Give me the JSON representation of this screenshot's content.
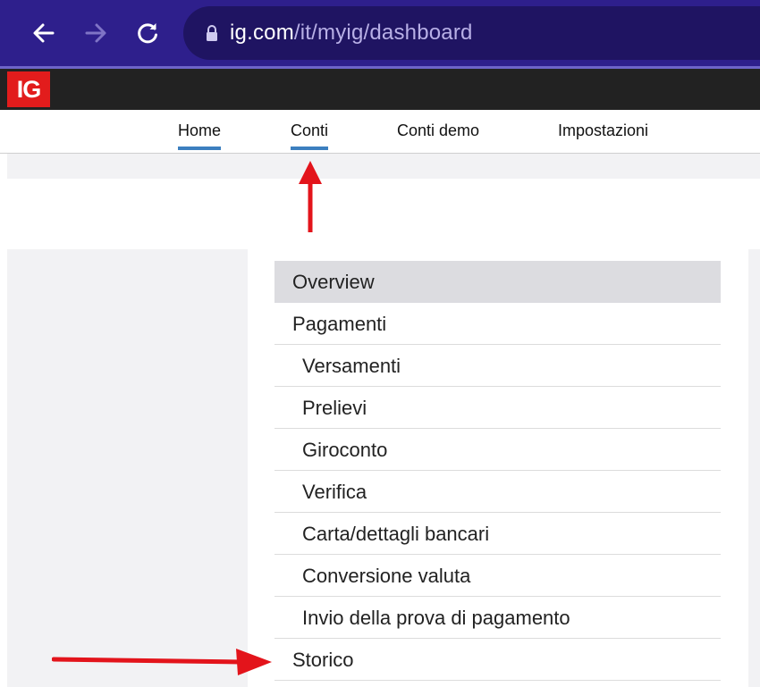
{
  "browser": {
    "url_host": "ig.com",
    "url_path": "/it/myig/dashboard"
  },
  "brand": {
    "logo_text": "IG",
    "logo_color": "#e21c1c",
    "bar_color": "#222222"
  },
  "colors": {
    "browser_bar": "#2e1f8c",
    "address_bar": "#1f1462",
    "tab_underline": "#3c7fbf",
    "arrow": "#e3141b"
  },
  "tabs": [
    {
      "label": "Home",
      "active": false
    },
    {
      "label": "Conti",
      "active": true
    },
    {
      "label": "Conti demo",
      "active": false
    },
    {
      "label": "Impostazioni",
      "active": false
    }
  ],
  "menu": {
    "items": [
      {
        "label": "Overview",
        "active": true
      },
      {
        "label": "Pagamenti"
      },
      {
        "label": "Versamenti"
      },
      {
        "label": "Prelievi"
      },
      {
        "label": "Giroconto"
      },
      {
        "label": "Verifica"
      },
      {
        "label": "Carta/dettagli bancari"
      },
      {
        "label": "Conversione valuta"
      },
      {
        "label": "Invio della prova di pagamento"
      },
      {
        "label": "Storico"
      }
    ]
  },
  "icons": {
    "back": "arrow-left-icon",
    "forward": "arrow-right-icon",
    "reload": "reload-icon",
    "lock": "lock-icon"
  }
}
